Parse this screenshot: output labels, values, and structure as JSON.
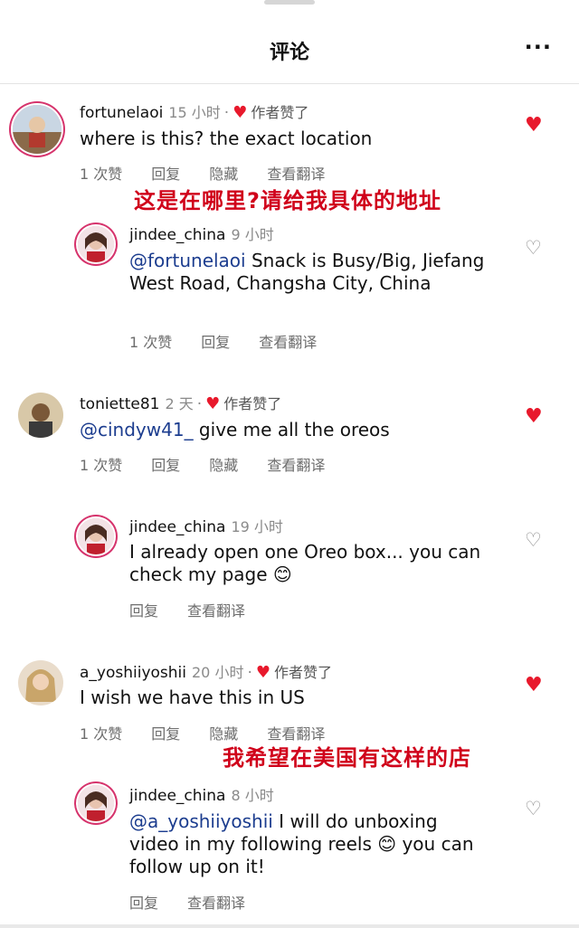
{
  "header": {
    "title": "评论",
    "more_icon": "ellipsis-icon"
  },
  "comments": [
    {
      "username": "fortunelaoi",
      "time": "15 小时",
      "liked_by_author": "作者赞了",
      "text": "where is this? the exact location",
      "likes": "1 次赞",
      "reply": "回复",
      "hide": "隐藏",
      "translate": "查看翻译",
      "annotation": "这是在哪里?请给我具体的地址",
      "reply_comment": {
        "username": "jindee_china",
        "time": "9 小时",
        "mention": "@fortunelaoi",
        "text_after_mention": " Snack is Busy/Big, Jiefang West Road, Changsha City, China",
        "likes": "1 次赞",
        "reply": "回复",
        "translate": "查看翻译"
      }
    },
    {
      "username": "toniette81",
      "time": "2 天",
      "liked_by_author": "作者赞了",
      "mention": "@cindyw41_",
      "text_after_mention": " give me all the oreos",
      "likes": "1 次赞",
      "reply": "回复",
      "hide": "隐藏",
      "translate": "查看翻译",
      "reply_comment": {
        "username": "jindee_china",
        "time": "19 小时",
        "text_before_emoji": "I already open one Oreo box... you can check my page ",
        "emoji": "😊",
        "reply": "回复",
        "translate": "查看翻译"
      }
    },
    {
      "username": "a_yoshiiyoshii",
      "time": "20 小时",
      "liked_by_author": "作者赞了",
      "text": "I wish we have this in US",
      "likes": "1 次赞",
      "reply": "回复",
      "hide": "隐藏",
      "translate": "查看翻译",
      "annotation": "我希望在美国有这样的店",
      "reply_comment": {
        "username": "jindee_china",
        "time": "8 小时",
        "mention": "@a_yoshiiyoshii",
        "text_mid": "  I will do unboxing video in my following reels ",
        "emoji": "😊",
        "text_end": " you can follow up on it!",
        "reply": "回复",
        "translate": "查看翻译"
      }
    }
  ],
  "colors": {
    "heart": "#e8192c",
    "annotation": "#d0021b",
    "mention": "#1c3d8f"
  }
}
